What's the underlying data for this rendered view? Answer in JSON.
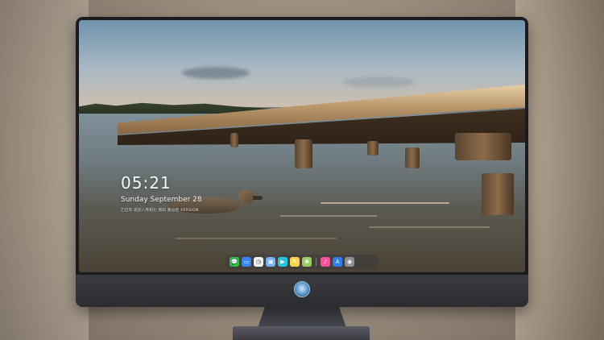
{
  "lockscreen": {
    "time": "05:21",
    "date": "Sunday September  28",
    "lunar_info": "乙巳年 农历八月初七 周日 秋分后 VERSION"
  },
  "dock": {
    "apps": [
      {
        "name": "messages-icon",
        "color": "#2fbf4b",
        "glyph": "💬"
      },
      {
        "name": "files-icon",
        "color": "#3b82f6",
        "glyph": "▭"
      },
      {
        "name": "clock-app-icon",
        "color": "#f2f2f2",
        "glyph": "◷"
      },
      {
        "name": "image-viewer-icon",
        "color": "#6fb3ff",
        "glyph": "▣"
      },
      {
        "name": "video-icon",
        "color": "#26c6da",
        "glyph": "▶"
      },
      {
        "name": "notes-icon",
        "color": "#ffd54f",
        "glyph": "✎"
      },
      {
        "name": "photos-icon",
        "color": "#9ccc65",
        "glyph": "❀"
      },
      {
        "name": "music-icon",
        "color": "#ff4f9a",
        "glyph": "♪"
      },
      {
        "name": "app-store-icon",
        "color": "#2f80ed",
        "glyph": "A"
      },
      {
        "name": "camera-icon",
        "color": "#8a8f98",
        "glyph": "◉"
      }
    ]
  }
}
